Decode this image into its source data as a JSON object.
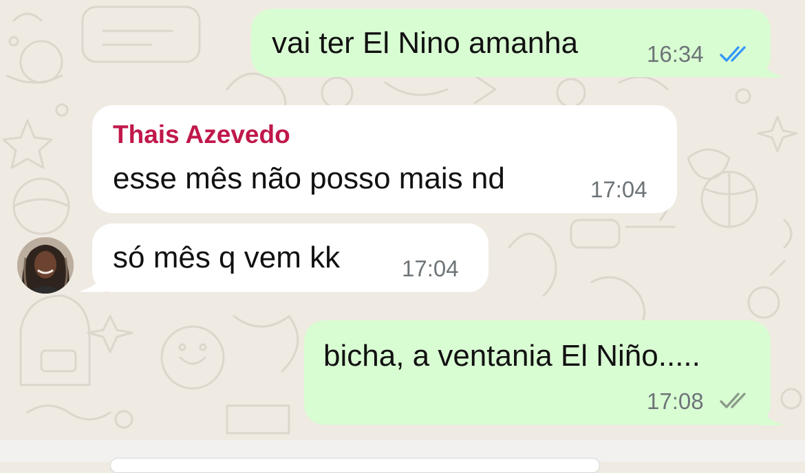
{
  "messages": [
    {
      "text": "vai ter El Nino amanha",
      "time": "16:34",
      "status": "read"
    },
    {
      "sender": "Thais Azevedo",
      "text": "esse mês não posso mais nd",
      "time": "17:04"
    },
    {
      "text": "só mês q vem kk",
      "time": "17:04"
    },
    {
      "text": "bicha, a ventania El Niño.....",
      "time": "17:08",
      "status": "delivered"
    }
  ],
  "colors": {
    "chat_background": "#efeae2",
    "outgoing_bubble": "#d9fdd3",
    "incoming_bubble": "#ffffff",
    "sender_name": "#c0184a",
    "read_tick": "#3497f9",
    "delivered_tick": "#8a9a8a"
  },
  "icons": {
    "read": "double-check-blue-icon",
    "delivered": "double-check-gray-icon"
  }
}
